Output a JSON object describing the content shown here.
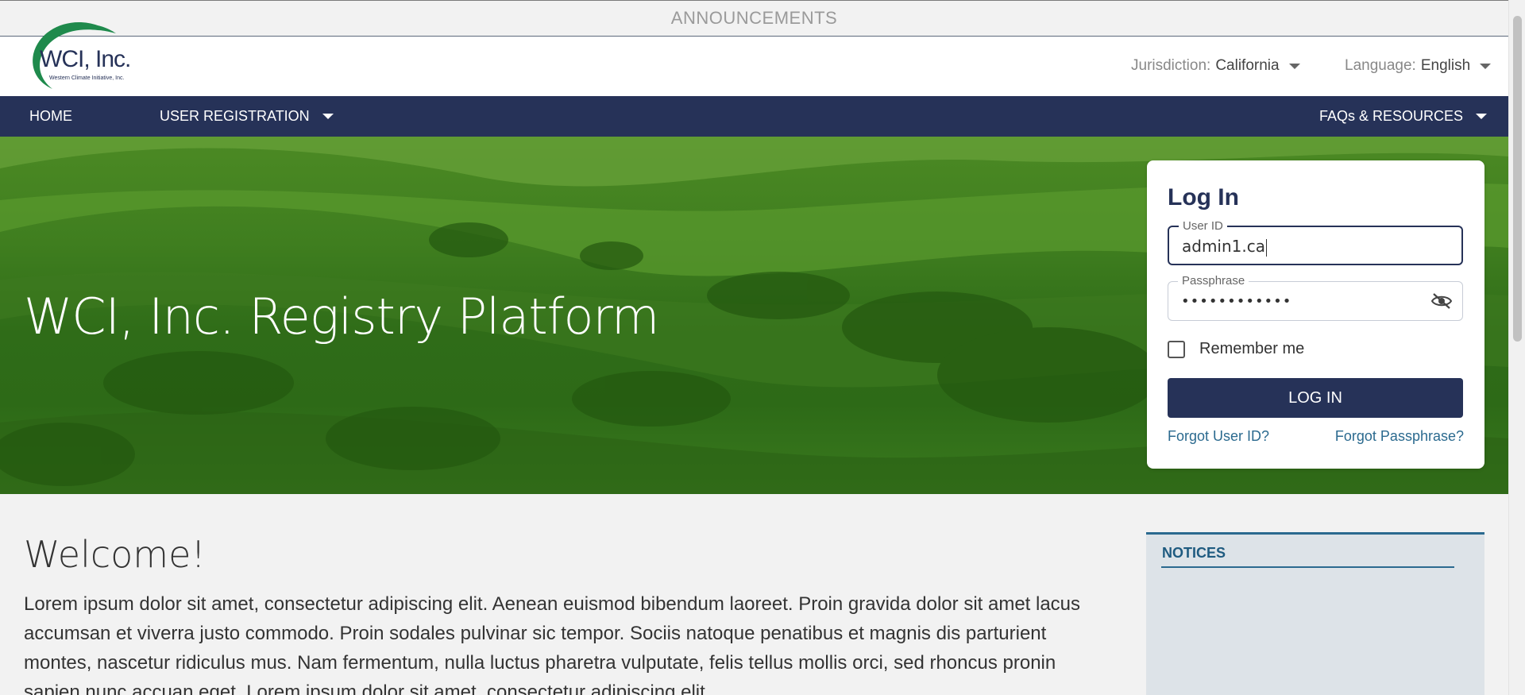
{
  "announcements": {
    "label": "ANNOUNCEMENTS"
  },
  "header": {
    "logo": {
      "name": "WCI, Inc.",
      "subtitle": "Western Climate Initiative, Inc."
    },
    "jurisdiction": {
      "label": "Jurisdiction:",
      "value": "California"
    },
    "language": {
      "label": "Language:",
      "value": "English"
    }
  },
  "nav": {
    "home": "HOME",
    "user_registration": "USER REGISTRATION",
    "faqs": "FAQs & RESOURCES"
  },
  "hero": {
    "title": "WCI, Inc. Registry Platform"
  },
  "login": {
    "title": "Log In",
    "user_id_label": "User ID",
    "user_id_value": "admin1.ca",
    "passphrase_label": "Passphrase",
    "passphrase_value": "••••••••••••",
    "remember_label": "Remember me",
    "button_label": "LOG IN",
    "forgot_user": "Forgot User ID?",
    "forgot_pass": "Forgot Passphrase?"
  },
  "welcome": {
    "title": "Welcome!",
    "text": "Lorem ipsum dolor sit amet, consectetur adipiscing elit. Aenean euismod bibendum laoreet. Proin gravida dolor sit amet lacus accumsan et viverra justo commodo. Proin sodales pulvinar sic tempor. Sociis natoque penatibus et magnis dis parturient montes, nascetur ridiculus mus. Nam fermentum, nulla luctus pharetra vulputate, felis tellus mollis orci, sed rhoncus pronin sapien nunc accuan eget. Lorem ipsum dolor sit amet, consectetur adipiscing elit."
  },
  "notices": {
    "title": "NOTICES"
  },
  "colors": {
    "navy": "#263258",
    "accent": "#2b6a8f",
    "logo_green": "#1f8a4c"
  },
  "icons": {
    "visibility": "eye-off-icon",
    "dropdown": "caret-down-icon"
  }
}
